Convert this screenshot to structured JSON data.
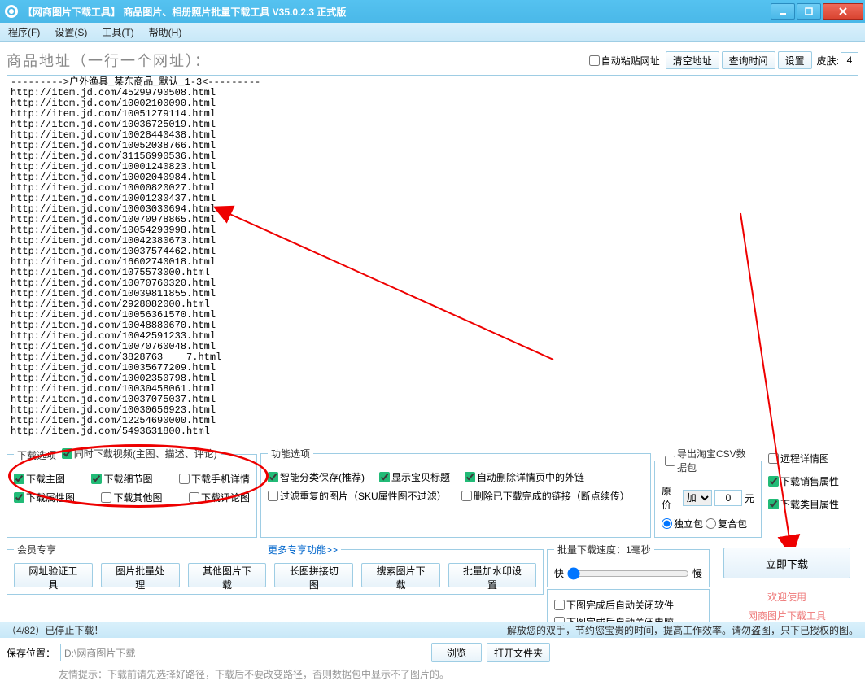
{
  "title": "【网商图片下载工具】 商品图片、相册照片批量下载工具  V35.0.2.3 正式版",
  "menu": {
    "program": "程序(F)",
    "settings": "设置(S)",
    "tools": "工具(T)",
    "help": "帮助(H)"
  },
  "addr": {
    "label": "商品地址（一行一个网址）：",
    "autopaste": "自动粘贴网址",
    "clear": "清空地址",
    "querytime": "查询时间",
    "settings": "设置",
    "skin_label": "皮肤:",
    "skin_value": "4"
  },
  "urls": "--------->户外渔具_某东商品_默认_1-3<---------\nhttp://item.jd.com/45299790508.html\nhttp://item.jd.com/10002100090.html\nhttp://item.jd.com/10051279114.html\nhttp://item.jd.com/10036725019.html\nhttp://item.jd.com/10028440438.html\nhttp://item.jd.com/10052038766.html\nhttp://item.jd.com/31156990536.html\nhttp://item.jd.com/10001240823.html\nhttp://item.jd.com/10002040984.html\nhttp://item.jd.com/10000820027.html\nhttp://item.jd.com/10001230437.html\nhttp://item.jd.com/10003030694.html\nhttp://item.jd.com/10070978865.html\nhttp://item.jd.com/10054293998.html\nhttp://item.jd.com/10042380673.html\nhttp://item.jd.com/10037574462.html\nhttp://item.jd.com/16602740018.html\nhttp://item.jd.com/1075573000.html\nhttp://item.jd.com/10070760320.html\nhttp://item.jd.com/10039811855.html\nhttp://item.jd.com/2928082000.html\nhttp://item.jd.com/10056361570.html\nhttp://item.jd.com/10048880670.html\nhttp://item.jd.com/10042591233.html\nhttp://item.jd.com/10070760048.html\nhttp://item.jd.com/3828763    7.html\nhttp://item.jd.com/10035677209.html\nhttp://item.jd.com/10002350798.html\nhttp://item.jd.com/10030458061.html\nhttp://item.jd.com/10037075037.html\nhttp://item.jd.com/10030656923.html\nhttp://item.jd.com/12254690000.html\nhttp://item.jd.com/5493631800.html",
  "download_options": {
    "legend_left": "下载选项",
    "legend_right": "同时下载视频(主图、描述、评论)",
    "main_img": "下载主图",
    "detail_img": "下载细节图",
    "mobile_detail": "下载手机详情",
    "attr_img": "下载属性图",
    "other_img": "下载其他图",
    "review_img": "下载评论图"
  },
  "func_options": {
    "legend": "功能选项",
    "smart_sort": "智能分类保存(推荐)",
    "show_title": "显示宝贝标题",
    "auto_delete_ext": "自动删除详情页中的外链",
    "filter_dup": "过滤重复的图片（SKU属性图不过滤）",
    "delete_done": "删除已下载完成的链接（断点续传）"
  },
  "csv": {
    "export": "导出淘宝CSV数据包",
    "orig_price": "原价",
    "mult_options": [
      "加"
    ],
    "mult_value": "0",
    "unit": "元",
    "pack_single": "独立包",
    "pack_compound": "复合包"
  },
  "remote": {
    "remote_detail": "远程详情图",
    "sale_attr": "下载销售属性",
    "cat_attr": "下载类目属性"
  },
  "member": {
    "legend": "会员专享",
    "more": "更多专享功能>>",
    "btn_verify": "网址验证工具",
    "btn_batch": "图片批量处理",
    "btn_other": "其他图片下载",
    "btn_longcut": "长图拼接切图",
    "btn_search": "搜索图片下载",
    "btn_watermark": "批量加水印设置"
  },
  "speed": {
    "legend": "批量下载速度：1毫秒",
    "fast": "快",
    "slow": "慢"
  },
  "autoclose": {
    "close_soft": "下图完成后自动关闭软件",
    "close_pc": "下图完成后自动关闭电脑"
  },
  "right": {
    "start": "立即下载",
    "welcome": "欢迎使用",
    "product": "网商图片下载工具"
  },
  "save": {
    "label": "保存位置：",
    "path": "D:\\网商图片下载",
    "browse": "浏览",
    "open": "打开文件夹",
    "hint": "友情提示：下载前请先选择好路径，下载后不要改变路径，否则数据包中显示不了图片的。"
  },
  "status": {
    "left": "（4/82）已停止下载！",
    "right": "解放您的双手，节约您宝贵的时间，提高工作效率。请勿盗图，只下已授权的图。"
  }
}
